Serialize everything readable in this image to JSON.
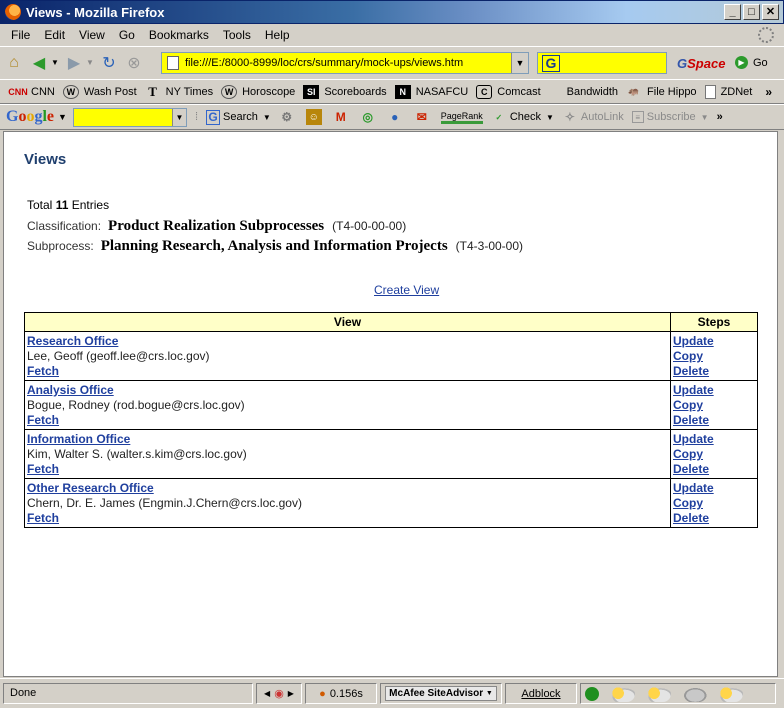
{
  "window": {
    "title": "Views - Mozilla Firefox"
  },
  "menu": [
    "File",
    "Edit",
    "View",
    "Go",
    "Bookmarks",
    "Tools",
    "Help"
  ],
  "nav": {
    "url": "file:///E:/8000-8999/loc/crs/summary/mock-ups/views.htm",
    "search_value": "",
    "gspace_label_g": "G",
    "gspace_label_rest": "Space",
    "go_label": "Go"
  },
  "bookmarks": [
    {
      "label": "CNN",
      "icon": "cnn-icon"
    },
    {
      "label": "Wash Post",
      "icon": "washpost-icon"
    },
    {
      "label": "NY Times",
      "icon": "nytimes-icon"
    },
    {
      "label": "Horoscope",
      "icon": "horoscope-icon"
    },
    {
      "label": "Scoreboards",
      "icon": "si-icon"
    },
    {
      "label": "NASAFCU",
      "icon": "nasafcu-icon"
    },
    {
      "label": "Comcast",
      "icon": "comcast-icon"
    },
    {
      "label": "Bandwidth",
      "icon": ""
    },
    {
      "label": "File Hippo",
      "icon": "filehippo-icon"
    },
    {
      "label": "ZDNet",
      "icon": "page-icon"
    }
  ],
  "google_toolbar": {
    "logo": "Google",
    "search_label": "Search",
    "pagerank_label": "PageRank",
    "check_label": "Check",
    "autolink_label": "AutoLink",
    "subscribe_label": "Subscribe"
  },
  "page": {
    "title": "Views",
    "total_prefix": "Total",
    "total_count": "11",
    "total_suffix": "Entries",
    "classification_label": "Classification:",
    "classification_name": "Product Realization Subprocesses",
    "classification_code": "(T4-00-00-00)",
    "subprocess_label": "Subprocess:",
    "subprocess_name": "Planning Research, Analysis and Information Projects",
    "subprocess_code": "(T4-3-00-00)",
    "create_view": "Create View",
    "table": {
      "headers": {
        "view": "View",
        "steps": "Steps"
      },
      "rows": [
        {
          "name": "Research Office",
          "person": "Lee, Geoff (geoff.lee@crs.loc.gov)",
          "fetch": "Fetch"
        },
        {
          "name": "Analysis Office",
          "person": "Bogue, Rodney (rod.bogue@crs.loc.gov)",
          "fetch": "Fetch"
        },
        {
          "name": "Information Office",
          "person": "Kim, Walter S. (walter.s.kim@crs.loc.gov)",
          "fetch": "Fetch"
        },
        {
          "name": "Other Research Office",
          "person": "Chern, Dr. E. James (Engmin.J.Chern@crs.loc.gov)",
          "fetch": "Fetch"
        }
      ],
      "step_labels": {
        "update": "Update",
        "copy": "Copy",
        "delete": "Delete"
      }
    }
  },
  "status": {
    "text": "Done",
    "timing": "0.156s",
    "mcafee": "McAfee SiteAdvisor",
    "adblock": "Adblock"
  }
}
